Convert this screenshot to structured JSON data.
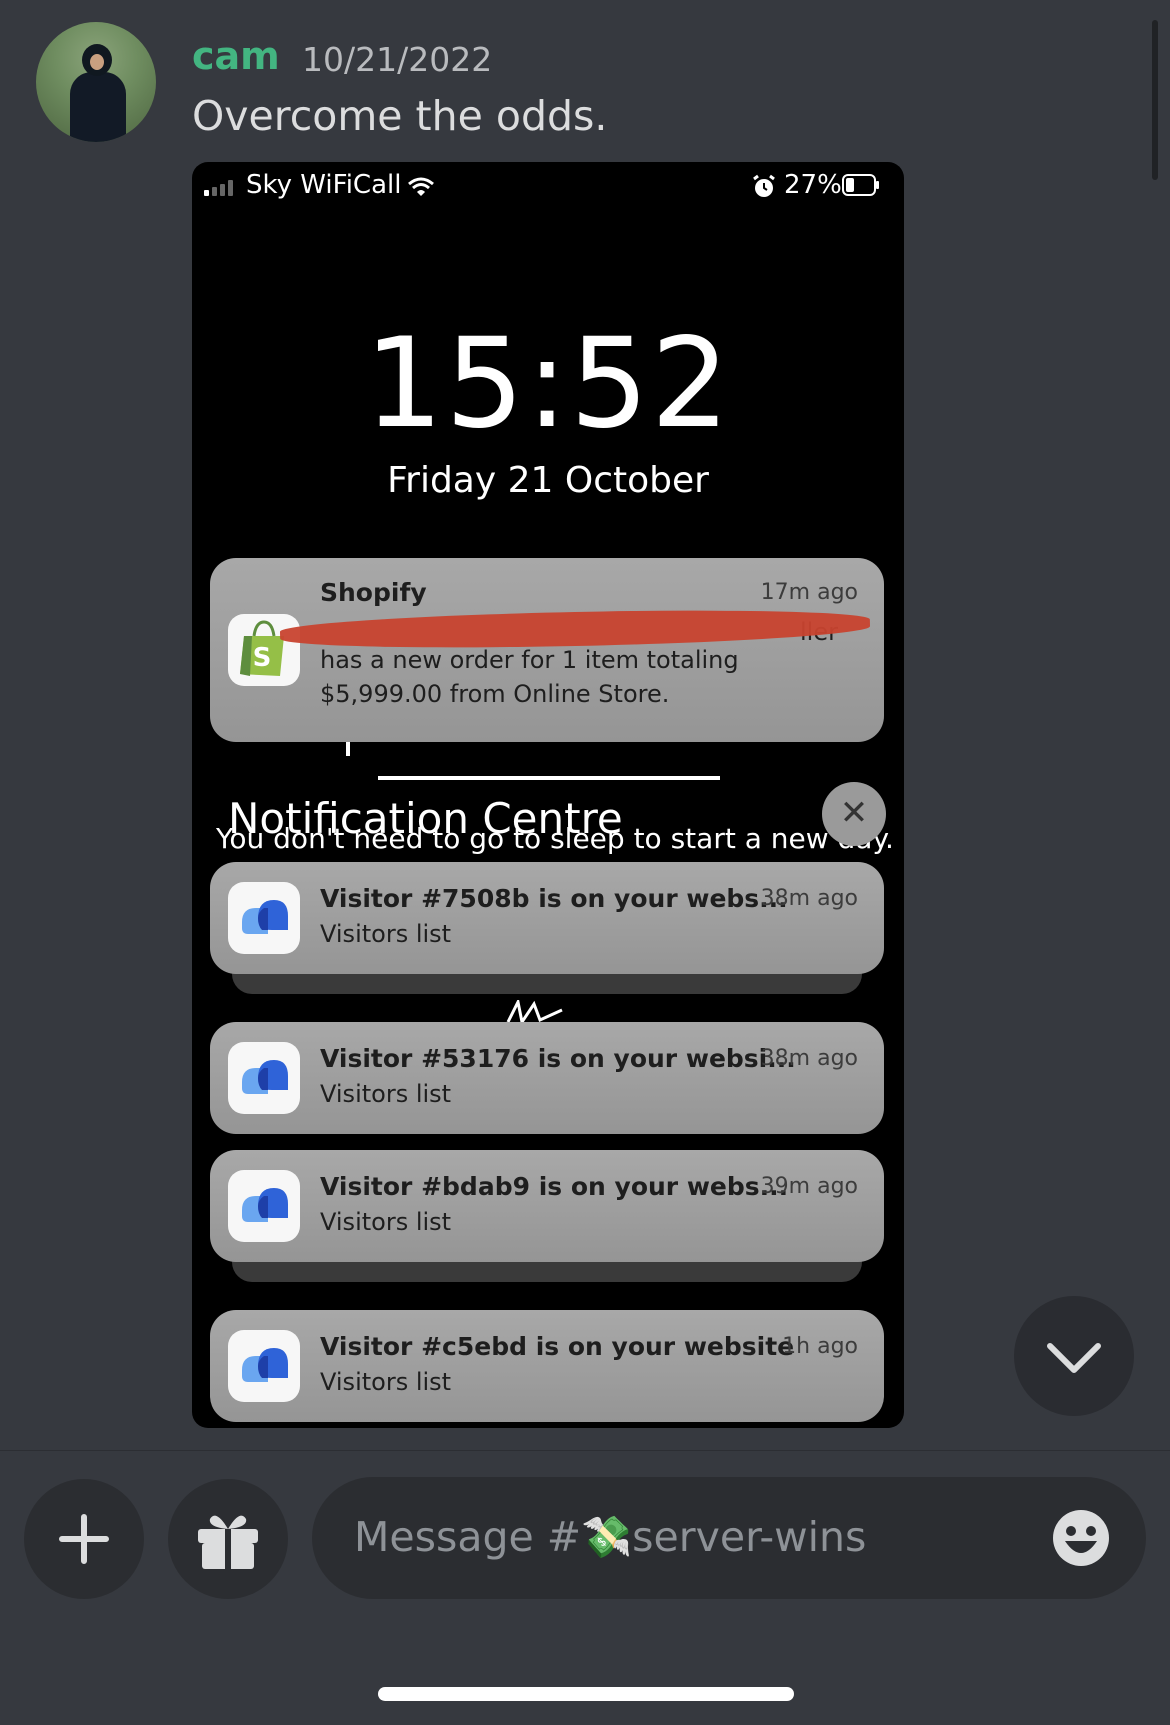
{
  "message": {
    "username": "cam",
    "timestamp": "10/21/2022",
    "text": "Overcome the odds."
  },
  "screenshot": {
    "status_bar": {
      "carrier": "Sky WiFiCall",
      "battery": "27%",
      "icons": [
        "signal-icon",
        "wifi-icon",
        "alarm-icon",
        "battery-icon"
      ]
    },
    "lock_time": "15:52",
    "lock_date": "Friday 21 October",
    "shopify": {
      "app": "Shopify",
      "time": "17m ago",
      "line2_left": "",
      "line2_right": "ller",
      "line3": "has a new order for 1 item totaling",
      "line4": "$5,999.00 from Online Store."
    },
    "notification_centre": {
      "title": "Notification Centre",
      "subtitle": "You don't need to go to sleep to start a new day.",
      "close_glyph": "✕"
    },
    "visitors": [
      {
        "title": "Visitor #7508b is on your webs...",
        "time": "38m ago",
        "body": "Visitors list"
      },
      {
        "title": "Visitor #53176 is on your websi...",
        "time": "38m ago",
        "body": "Visitors list"
      },
      {
        "title": "Visitor #bdab9 is on your webs...",
        "time": "39m ago",
        "body": "Visitors list"
      },
      {
        "title": "Visitor #c5ebd is on your website",
        "time": "1h ago",
        "body": "Visitors list"
      }
    ]
  },
  "composer": {
    "placeholder_prefix": "Message #",
    "channel_emoji": "💸",
    "placeholder_channel": "server-wins"
  },
  "colors": {
    "background": "#36393f",
    "username": "#43b581",
    "redaction": "#c8432f"
  }
}
